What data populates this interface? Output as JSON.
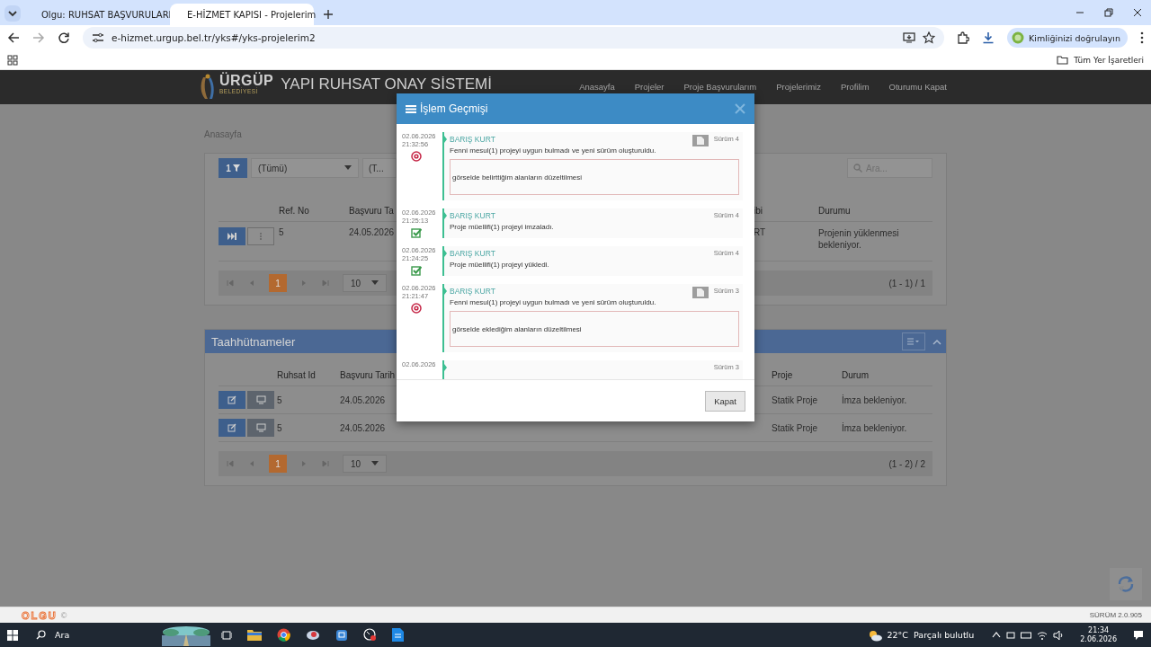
{
  "browser": {
    "tabs": [
      {
        "title": "Olgu: RUHSAT BAŞVURULARI",
        "selected": false
      },
      {
        "title": "E-HİZMET KAPISI - Projelerim",
        "selected": true
      }
    ],
    "url": "e-hizmet.urgup.bel.tr/yks#/yks-projelerim2",
    "profile_button": "Kimliğinizi doğrulayın",
    "bookmarks_label": "Tüm Yer İşaretleri"
  },
  "app": {
    "logo": {
      "name": "ÜRGÜP",
      "subtitle": "BELEDİYESİ"
    },
    "title": "YAPI RUHSAT ONAY SİSTEMİ",
    "nav": [
      "Anasayfa",
      "Projeler",
      "Proje Başvurularım",
      "Projelerimiz",
      "Profilim",
      "Oturumu Kapat"
    ],
    "breadcrumb": "Anasayfa"
  },
  "projects": {
    "filter_count": "1",
    "filters": [
      "(Tümü)",
      "(T..."
    ],
    "search": {
      "placeholder": "Ara..."
    },
    "columns_left": [
      "Ref. No",
      "Başvuru Ta"
    ],
    "columns_right": [
      "ibi",
      "Durumu"
    ],
    "rows": [
      {
        "ref": "5",
        "date": "24.05.2026",
        "column_3": "RT",
        "status": "Projenin yüklenmesi bekleniyor."
      }
    ],
    "pager": {
      "pages": [
        {
          "label": "1",
          "selected": true
        }
      ],
      "page_size": "10",
      "summary": "(1 - 1) / 1"
    }
  },
  "commitments": {
    "title": "Taahhütnameler",
    "columns_left": [
      "Ruhsat Id",
      "Başvuru Tarih"
    ],
    "columns_right": [
      "Proje",
      "Durum"
    ],
    "rows": [
      {
        "id": "5",
        "date": "24.05.2026",
        "project": "Statik Proje",
        "status": "İmza bekleniyor."
      },
      {
        "id": "5",
        "date": "24.05.2026",
        "project": "Statik Proje",
        "status": "İmza bekleniyor."
      }
    ],
    "pager": {
      "pages": [
        {
          "label": "1",
          "selected": true
        }
      ],
      "page_size": "10",
      "summary": "(1 - 2) / 2"
    }
  },
  "modal": {
    "title": "İşlem Geçmişi",
    "entries": [
      {
        "date": "02.06.2026",
        "time": "21:32:56",
        "kind": "rejected",
        "user": "BARIŞ KURT",
        "version": "Sürüm 4",
        "has_document": true,
        "message": "Fenni mesul(1) projeyi uygun bulmadı ve yeni sürüm oluşturuldu.",
        "note": "görselde belirttiğim alanların düzeltilmesi"
      },
      {
        "date": "02.06.2026",
        "time": "21:25:13",
        "kind": "approved",
        "user": "BARIŞ KURT",
        "version": "Sürüm 4",
        "has_document": false,
        "message": "Proje müellifi(1) projeyi imzaladı."
      },
      {
        "date": "02.06.2026",
        "time": "21:24:25",
        "kind": "approved",
        "user": "BARIŞ KURT",
        "version": "Sürüm 4",
        "has_document": false,
        "message": "Proje müellifi(1) projeyi yükledi."
      },
      {
        "date": "02.06.2026",
        "time": "21:21:47",
        "kind": "rejected",
        "user": "BARIŞ KURT",
        "version": "Sürüm 3",
        "has_document": true,
        "message": "Fenni mesul(1) projeyi uygun bulmadı ve yeni sürüm oluşturuldu.",
        "note": "görselde eklediğim alanların düzeltilmesi"
      },
      {
        "date": "02.06.2026",
        "version": "Sürüm 3",
        "has_document": false
      }
    ],
    "close_button": "Kapat"
  },
  "footer": {
    "brand": "OLGU",
    "copyright": "©",
    "version": "SÜRÜM 2.0.905"
  },
  "taskbar": {
    "search": "Ara",
    "temperature": "22°C",
    "weather": "Parçalı bulutlu",
    "time": "21:34",
    "date": "2.06.2026"
  }
}
